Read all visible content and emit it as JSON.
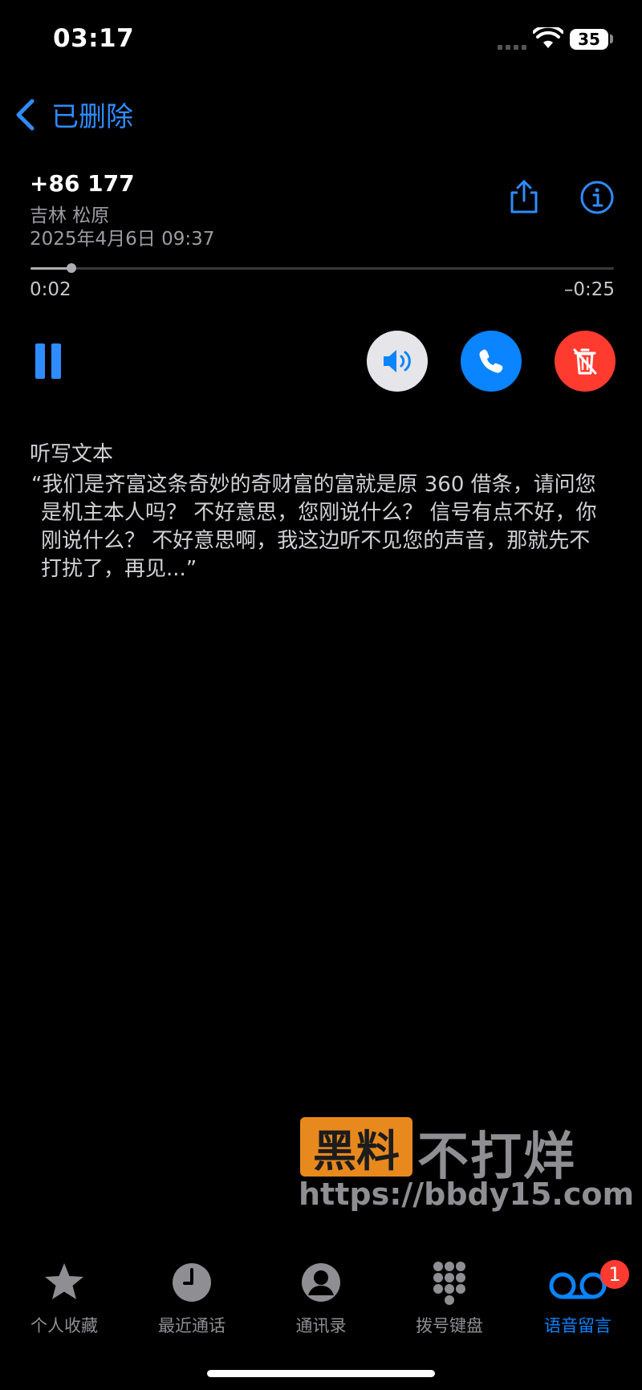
{
  "status_bar": {
    "time": "03:17",
    "battery": "35"
  },
  "nav": {
    "back_label": "已删除",
    "icon": "chevron-left-icon"
  },
  "voicemail": {
    "number": "+86 177",
    "location": "吉林 松原",
    "date": "2025年4月6日 09:37",
    "progress_fraction": 0.07,
    "elapsed": "0:02",
    "remaining": "–0:25"
  },
  "transcript": {
    "title": "听写文本",
    "text": "“我们是齐富这条奇妙的奇财富的富就是原 360 借条，请问您是机主本人吗？ 不好意思，您刚说什么？ 信号有点不好，你刚说什么？ 不好意思啊，我这边听不见您的声音，那就先不打扰了，再见...”"
  },
  "watermark": {
    "box_text": "黑料",
    "text": "不打烊",
    "url": "https://bbdy15.com"
  },
  "tabs": [
    {
      "label": "个人收藏",
      "icon": "star-icon"
    },
    {
      "label": "最近通话",
      "icon": "clock-icon"
    },
    {
      "label": "通讯录",
      "icon": "contact-icon"
    },
    {
      "label": "拨号键盘",
      "icon": "keypad-icon"
    },
    {
      "label": "语音留言",
      "icon": "voicemail-icon",
      "badge": "1"
    }
  ],
  "colors": {
    "accent": "#0a84ff",
    "destructive": "#ff3b30",
    "watermark_box": "#e8891e"
  }
}
